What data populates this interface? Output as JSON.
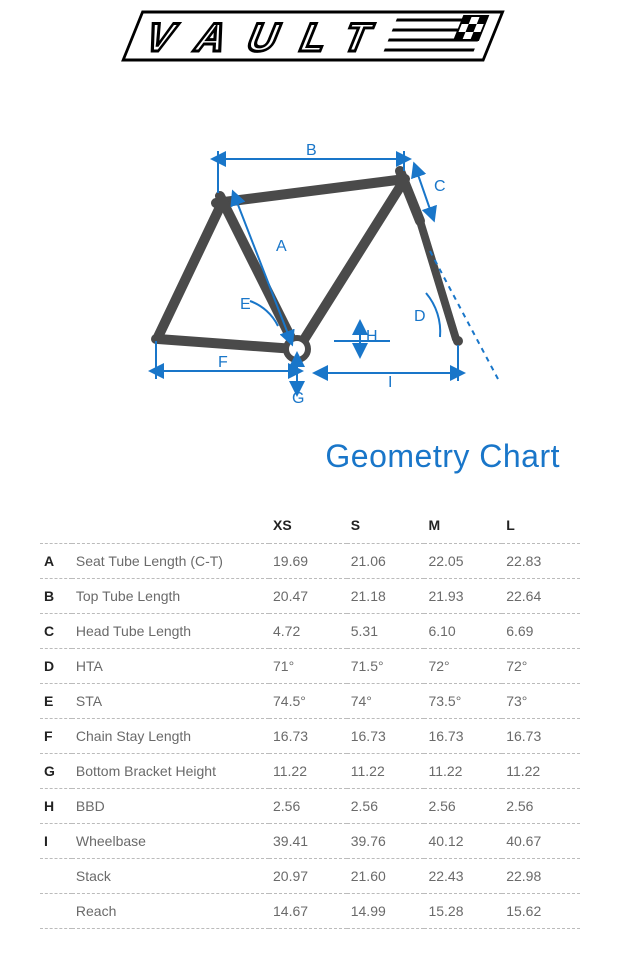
{
  "logo_text": "VAULT",
  "title": "Geometry Chart",
  "sizes": [
    "XS",
    "S",
    "M",
    "L"
  ],
  "diagram_labels": [
    "A",
    "B",
    "C",
    "D",
    "E",
    "F",
    "G",
    "H",
    "I"
  ],
  "rows": [
    {
      "letter": "A",
      "name": "Seat Tube Length (C-T)",
      "values": [
        "19.69",
        "21.06",
        "22.05",
        "22.83"
      ]
    },
    {
      "letter": "B",
      "name": "Top Tube Length",
      "values": [
        "20.47",
        "21.18",
        "21.93",
        "22.64"
      ]
    },
    {
      "letter": "C",
      "name": "Head Tube Length",
      "values": [
        "4.72",
        "5.31",
        "6.10",
        "6.69"
      ]
    },
    {
      "letter": "D",
      "name": "HTA",
      "values": [
        "71°",
        "71.5°",
        "72°",
        "72°"
      ]
    },
    {
      "letter": "E",
      "name": "STA",
      "values": [
        "74.5°",
        "74°",
        "73.5°",
        "73°"
      ]
    },
    {
      "letter": "F",
      "name": "Chain Stay Length",
      "values": [
        "16.73",
        "16.73",
        "16.73",
        "16.73"
      ]
    },
    {
      "letter": "G",
      "name": "Bottom Bracket Height",
      "values": [
        "11.22",
        "11.22",
        "11.22",
        "11.22"
      ]
    },
    {
      "letter": "H",
      "name": "BBD",
      "values": [
        "2.56",
        "2.56",
        "2.56",
        "2.56"
      ]
    },
    {
      "letter": "I",
      "name": "Wheelbase",
      "values": [
        "39.41",
        "39.76",
        "40.12",
        "40.67"
      ]
    },
    {
      "letter": "",
      "name": "Stack",
      "values": [
        "20.97",
        "21.60",
        "22.43",
        "22.98"
      ]
    },
    {
      "letter": "",
      "name": "Reach",
      "values": [
        "14.67",
        "14.99",
        "15.28",
        "15.62"
      ]
    }
  ],
  "chart_data": {
    "type": "table",
    "title": "Geometry Chart",
    "categories": [
      "XS",
      "S",
      "M",
      "L"
    ],
    "series": [
      {
        "name": "Seat Tube Length (C-T)",
        "values": [
          19.69,
          21.06,
          22.05,
          22.83
        ]
      },
      {
        "name": "Top Tube Length",
        "values": [
          20.47,
          21.18,
          21.93,
          22.64
        ]
      },
      {
        "name": "Head Tube Length",
        "values": [
          4.72,
          5.31,
          6.1,
          6.69
        ]
      },
      {
        "name": "HTA",
        "values": [
          71,
          71.5,
          72,
          72
        ]
      },
      {
        "name": "STA",
        "values": [
          74.5,
          74,
          73.5,
          73
        ]
      },
      {
        "name": "Chain Stay Length",
        "values": [
          16.73,
          16.73,
          16.73,
          16.73
        ]
      },
      {
        "name": "Bottom Bracket Height",
        "values": [
          11.22,
          11.22,
          11.22,
          11.22
        ]
      },
      {
        "name": "BBD",
        "values": [
          2.56,
          2.56,
          2.56,
          2.56
        ]
      },
      {
        "name": "Wheelbase",
        "values": [
          39.41,
          39.76,
          40.12,
          40.67
        ]
      },
      {
        "name": "Stack",
        "values": [
          20.97,
          21.6,
          22.43,
          22.98
        ]
      },
      {
        "name": "Reach",
        "values": [
          14.67,
          14.99,
          15.28,
          15.62
        ]
      }
    ]
  }
}
